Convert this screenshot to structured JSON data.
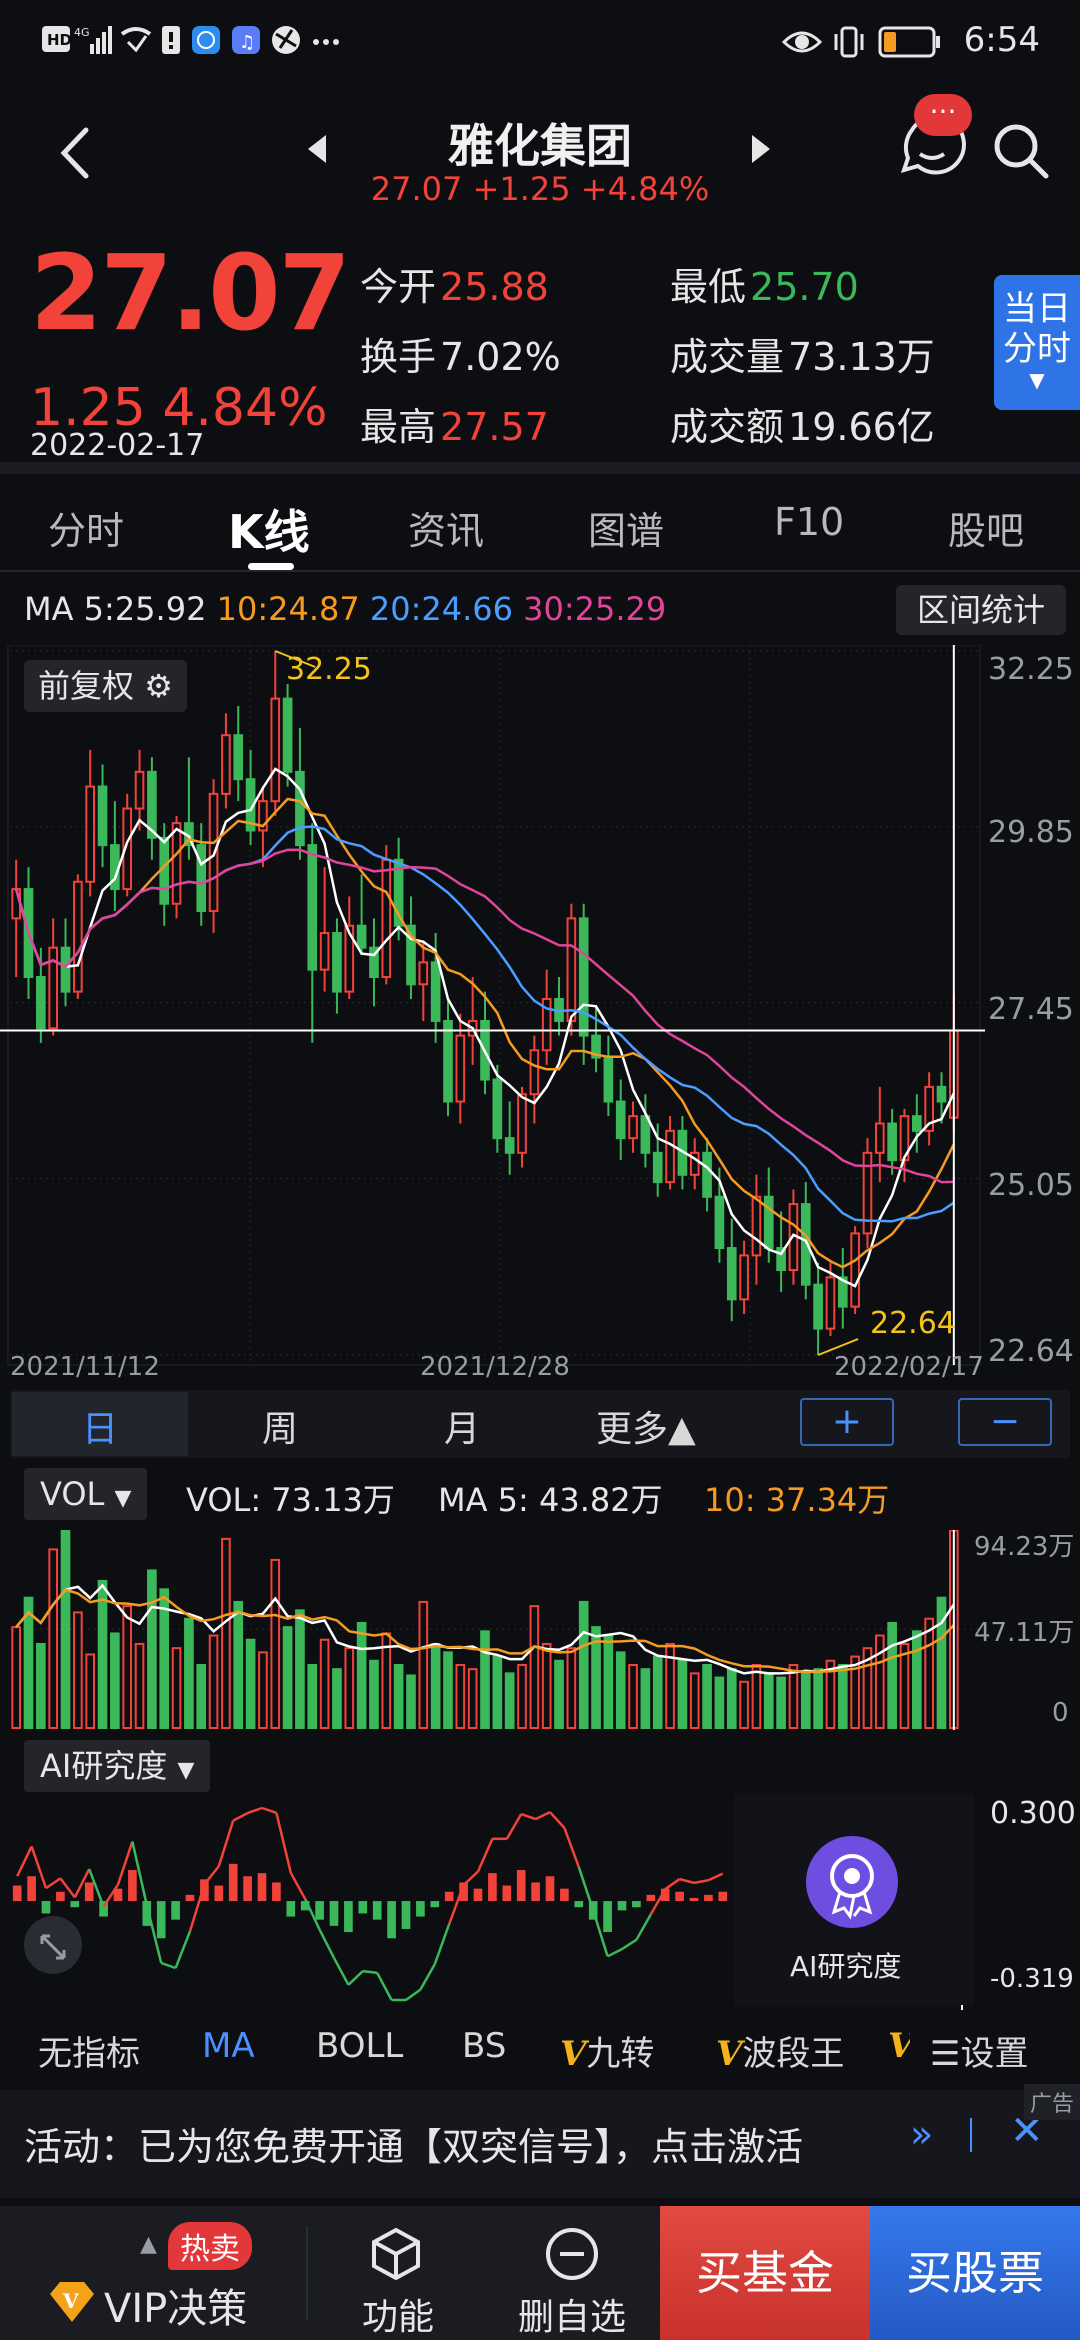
{
  "status_bar": {
    "icons": [
      "hd-icon",
      "signal-4g-icon",
      "missed-call-icon",
      "battery-saver-icon",
      "app-icon-blue",
      "music-icon",
      "ball-icon",
      "more-dots-icon"
    ],
    "right_icons": [
      "eye-icon",
      "vibrate-icon",
      "battery-low-icon"
    ],
    "time": "6:54"
  },
  "header": {
    "title": "雅化集团",
    "price": "27.07",
    "change": "+1.25",
    "change_pct": "+4.84%",
    "chat_badge": "···"
  },
  "quote": {
    "price": "27.07",
    "change": "1.25",
    "change_pct": "4.84%",
    "date": "2022-02-17",
    "open_label": "今开",
    "open": "25.88",
    "low_label": "最低",
    "low": "25.70",
    "turnover_label": "换手",
    "turnover": "7.02%",
    "volume_label": "成交量",
    "volume": "73.13万",
    "high_label": "最高",
    "high": "27.57",
    "amount_label": "成交额",
    "amount": "19.66亿",
    "today_btn_line1": "当日",
    "today_btn_line2": "分时"
  },
  "tabs": [
    "分时",
    "K线",
    "资讯",
    "图谱",
    "F10",
    "股吧"
  ],
  "active_tab": "K线",
  "ma_line": {
    "ma5": "MA 5:25.92",
    "ma10": "10:24.87",
    "ma20": "20:24.66",
    "ma30": "30:25.29",
    "range_btn": "区间统计"
  },
  "kline": {
    "fuquan": "前复权",
    "y_ticks": [
      "32.25",
      "29.85",
      "27.45",
      "25.05",
      "22.64"
    ],
    "x_start": "2021/11/12",
    "x_mid": "2021/12/28",
    "x_end": "2022/02/17",
    "max_label": "32.25",
    "min_label": "22.64"
  },
  "periods": [
    "日",
    "周",
    "月",
    "更多▲"
  ],
  "zoom_in": "+",
  "zoom_out": "−",
  "vol": {
    "selector": "VOL",
    "vol_label": "VOL:",
    "vol_value": "73.13万",
    "ma5_label": "MA 5:",
    "ma5_value": "43.82万",
    "ma10_label": "10:",
    "ma10_value": "37.34万",
    "y_ticks": [
      "94.23万",
      "47.11万",
      "0"
    ]
  },
  "ai_panel": {
    "selector": "AI研究度",
    "y_top": "0.300",
    "y_bottom": "-0.319",
    "badge_label": "AI研究度"
  },
  "indicator_bar": {
    "items": [
      "无指标",
      "MA",
      "BOLL",
      "BS",
      "九转",
      "波段王"
    ],
    "active": "MA",
    "settings": "设置"
  },
  "banner": {
    "text": "活动：已为您免费开通【双突信号】，点击激活",
    "ad": "广告"
  },
  "bottom_nav": {
    "vip": "VIP决策",
    "hot": "热卖",
    "func": "功能",
    "remove": "删自选",
    "buy_fund": "买基金",
    "buy_stock": "买股票"
  },
  "colors": {
    "up": "#f2433a",
    "down": "#3bb85a",
    "ma5": "#ffffff",
    "ma10": "#f59a23",
    "ma20": "#4a9eff",
    "ma30": "#e0459a",
    "accent": "#2f74e6"
  },
  "chart_data": [
    {
      "type": "candlestick",
      "title": "雅化集团 K线 (日)",
      "x_range": [
        "2021/11/12",
        "2022/02/17"
      ],
      "ylim": [
        22.64,
        32.25
      ],
      "y_ticks": [
        32.25,
        29.85,
        27.45,
        25.05,
        22.64
      ],
      "annotations": [
        {
          "label": "32.25",
          "type": "max"
        },
        {
          "label": "22.64",
          "type": "min"
        }
      ],
      "candles": [
        [
          28.6,
          29.4,
          27.8,
          29.0
        ],
        [
          29.0,
          29.3,
          27.5,
          27.8
        ],
        [
          27.8,
          28.2,
          26.9,
          27.1
        ],
        [
          27.1,
          28.6,
          27.0,
          28.2
        ],
        [
          28.2,
          28.6,
          27.4,
          27.6
        ],
        [
          27.6,
          29.2,
          27.5,
          29.1
        ],
        [
          29.1,
          30.9,
          28.9,
          30.4
        ],
        [
          30.4,
          30.7,
          29.3,
          29.6
        ],
        [
          29.6,
          30.2,
          28.7,
          29.0
        ],
        [
          29.0,
          30.3,
          28.9,
          30.1
        ],
        [
          30.1,
          30.9,
          29.8,
          30.6
        ],
        [
          30.6,
          30.8,
          29.4,
          29.7
        ],
        [
          29.7,
          29.9,
          28.5,
          28.8
        ],
        [
          28.8,
          30.0,
          28.6,
          29.9
        ],
        [
          29.9,
          30.8,
          29.4,
          29.6
        ],
        [
          29.6,
          29.9,
          28.5,
          28.7
        ],
        [
          28.7,
          30.5,
          28.4,
          30.3
        ],
        [
          30.3,
          31.4,
          30.1,
          31.1
        ],
        [
          31.1,
          31.5,
          30.2,
          30.5
        ],
        [
          30.5,
          30.9,
          29.6,
          29.8
        ],
        [
          29.8,
          30.4,
          29.3,
          30.2
        ],
        [
          30.2,
          32.25,
          30.0,
          31.6
        ],
        [
          31.6,
          31.8,
          30.4,
          30.6
        ],
        [
          30.6,
          31.2,
          29.4,
          29.6
        ],
        [
          29.6,
          29.9,
          26.9,
          27.9
        ],
        [
          27.9,
          29.3,
          27.6,
          28.4
        ],
        [
          28.4,
          28.6,
          27.3,
          27.6
        ],
        [
          27.6,
          28.9,
          27.5,
          28.5
        ],
        [
          28.5,
          29.2,
          28.1,
          28.2
        ],
        [
          28.2,
          28.6,
          27.4,
          27.8
        ],
        [
          27.8,
          29.6,
          27.7,
          29.4
        ],
        [
          29.4,
          29.7,
          28.3,
          28.5
        ],
        [
          28.5,
          28.9,
          27.5,
          27.7
        ],
        [
          27.7,
          28.3,
          27.2,
          28.0
        ],
        [
          28.0,
          28.4,
          26.9,
          27.2
        ],
        [
          27.2,
          27.5,
          25.9,
          26.1
        ],
        [
          26.1,
          27.3,
          25.8,
          27.0
        ],
        [
          27.0,
          27.8,
          26.6,
          27.2
        ],
        [
          27.2,
          27.6,
          26.2,
          26.4
        ],
        [
          26.4,
          26.6,
          25.4,
          25.6
        ],
        [
          25.6,
          26.1,
          25.1,
          25.4
        ],
        [
          25.4,
          26.3,
          25.2,
          26.2
        ],
        [
          26.2,
          27.0,
          25.8,
          26.8
        ],
        [
          26.8,
          27.9,
          26.6,
          27.5
        ],
        [
          27.5,
          27.8,
          27.0,
          27.2
        ],
        [
          27.2,
          28.8,
          27.0,
          28.6
        ],
        [
          28.6,
          28.8,
          26.6,
          27.0
        ],
        [
          27.0,
          27.4,
          26.5,
          26.7
        ],
        [
          26.7,
          27.0,
          25.9,
          26.1
        ],
        [
          26.1,
          26.4,
          25.3,
          25.6
        ],
        [
          25.6,
          26.1,
          25.4,
          25.9
        ],
        [
          25.9,
          26.2,
          25.2,
          25.4
        ],
        [
          25.4,
          25.8,
          24.8,
          25.0
        ],
        [
          25.0,
          25.9,
          24.9,
          25.7
        ],
        [
          25.7,
          25.9,
          24.9,
          25.1
        ],
        [
          25.1,
          25.6,
          24.9,
          25.4
        ],
        [
          25.4,
          25.6,
          24.6,
          24.8
        ],
        [
          24.8,
          25.2,
          23.9,
          24.1
        ],
        [
          24.1,
          24.5,
          23.1,
          23.4
        ],
        [
          23.4,
          24.2,
          23.2,
          24.0
        ],
        [
          24.0,
          25.1,
          23.6,
          24.8
        ],
        [
          24.8,
          25.2,
          23.9,
          24.1
        ],
        [
          24.1,
          24.6,
          23.5,
          23.8
        ],
        [
          23.8,
          24.9,
          23.6,
          24.7
        ],
        [
          24.7,
          25.0,
          23.4,
          23.6
        ],
        [
          23.6,
          23.9,
          22.64,
          23.0
        ],
        [
          23.0,
          23.9,
          22.9,
          23.7
        ],
        [
          23.7,
          24.1,
          23.0,
          23.3
        ],
        [
          23.3,
          24.4,
          23.2,
          24.3
        ],
        [
          24.3,
          25.6,
          24.1,
          25.4
        ],
        [
          25.4,
          26.3,
          25.0,
          25.8
        ],
        [
          25.8,
          26.0,
          25.1,
          25.3
        ],
        [
          25.3,
          26.0,
          25.0,
          25.9
        ],
        [
          25.9,
          26.2,
          25.4,
          25.7
        ],
        [
          25.7,
          26.5,
          25.5,
          26.3
        ],
        [
          26.3,
          26.5,
          25.8,
          26.1
        ],
        [
          25.88,
          27.57,
          25.7,
          27.07
        ]
      ]
    },
    {
      "type": "bar",
      "title": "VOL",
      "ylim": [
        0,
        94.23
      ],
      "unit": "万",
      "y_ticks": [
        94.23,
        47.11,
        0
      ],
      "values": [
        48,
        62,
        40,
        85,
        94,
        55,
        35,
        70,
        45,
        58,
        40,
        75,
        66,
        38,
        52,
        30,
        44,
        90,
        60,
        42,
        36,
        80,
        48,
        56,
        30,
        42,
        28,
        38,
        50,
        32,
        45,
        30,
        25,
        60,
        40,
        36,
        30,
        28,
        46,
        34,
        26,
        30,
        58,
        40,
        32,
        38,
        60,
        48,
        44,
        36,
        30,
        28,
        34,
        40,
        32,
        26,
        30,
        24,
        28,
        22,
        30,
        26,
        24,
        30,
        26,
        28,
        32,
        30,
        34,
        38,
        44,
        50,
        40,
        46,
        52,
        62,
        94
      ],
      "ma5": "43.82万",
      "ma10": "37.34万"
    },
    {
      "type": "bar",
      "title": "AI研究度",
      "ylim": [
        -0.319,
        0.3
      ],
      "values": [
        0.05,
        0.08,
        -0.04,
        0.03,
        -0.02,
        0.06,
        -0.05,
        0.04,
        0.1,
        -0.08,
        -0.12,
        -0.06,
        0.02,
        0.07,
        0.05,
        0.12,
        0.08,
        0.09,
        0.06,
        -0.05,
        -0.03,
        -0.06,
        -0.08,
        -0.1,
        -0.04,
        -0.06,
        -0.12,
        -0.09,
        -0.05,
        -0.02,
        0.03,
        0.06,
        0.04,
        0.09,
        0.05,
        0.1,
        0.06,
        0.08,
        0.04,
        -0.02,
        -0.06,
        -0.1,
        -0.03,
        -0.02,
        0.02,
        0.04,
        0.03,
        0.01,
        0.02,
        0.03
      ]
    }
  ]
}
